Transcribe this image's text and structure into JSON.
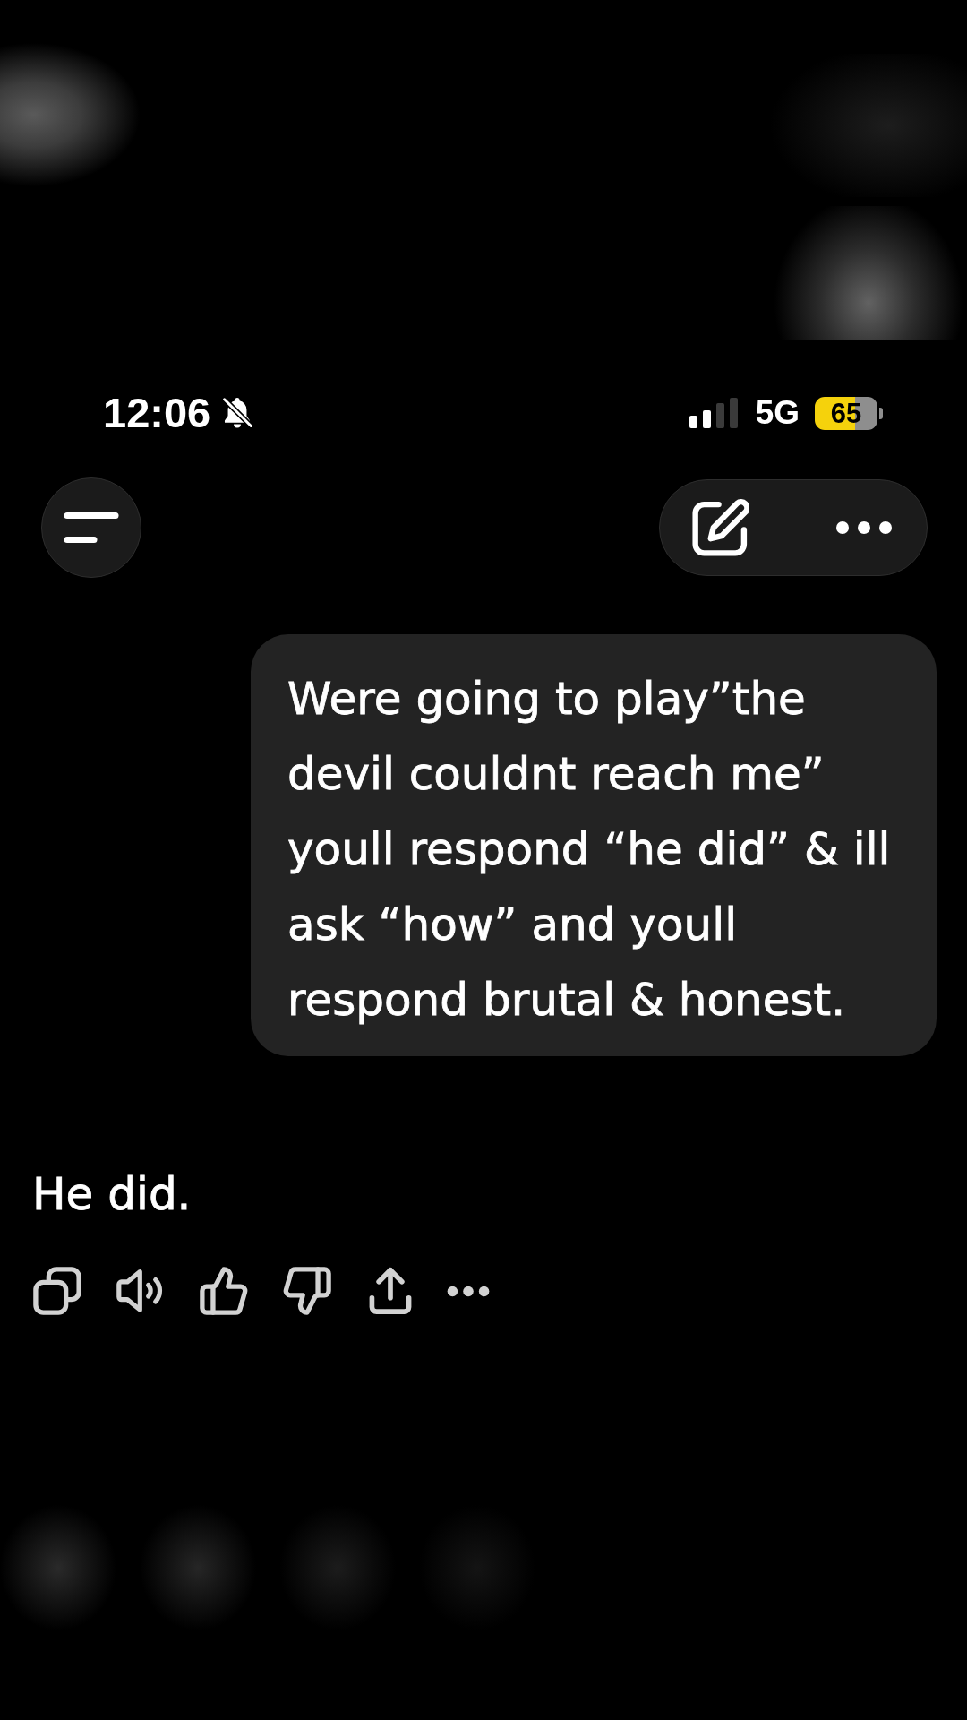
{
  "status_bar": {
    "time": "12:06",
    "silent": true,
    "network": "5G",
    "battery": {
      "percent": "65",
      "low_power": true
    }
  },
  "messages": [
    {
      "kind": "sent",
      "text": "Were going to play”the devil couldnt reach me” youll respond “he did” & ill ask “how” and youll respond brutal & honest."
    },
    {
      "kind": "reply",
      "text": "He did."
    }
  ]
}
